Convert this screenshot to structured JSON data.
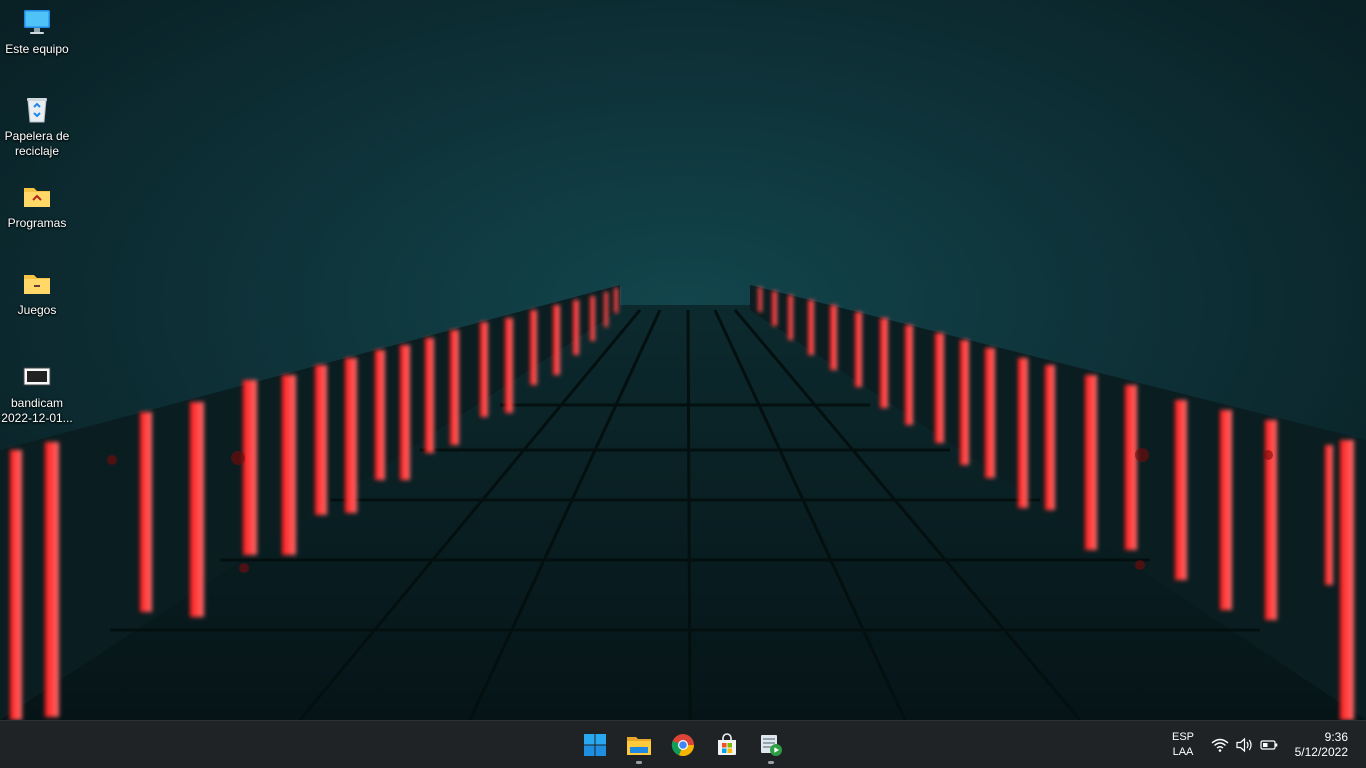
{
  "desktop": {
    "icons": [
      {
        "name": "este-equipo",
        "label": "Este equipo",
        "icon": "monitor-icon"
      },
      {
        "name": "papelera",
        "label": "Papelera de reciclaje",
        "icon": "recycle-bin-icon"
      },
      {
        "name": "programas",
        "label": "Programas",
        "icon": "folder-icon"
      },
      {
        "name": "juegos",
        "label": "Juegos",
        "icon": "folder-icon"
      },
      {
        "name": "bandicam",
        "label": "bandicam 2022-12-01...",
        "icon": "video-file-icon"
      }
    ]
  },
  "taskbar": {
    "apps": [
      {
        "name": "start",
        "icon": "windows-start-icon",
        "running": false
      },
      {
        "name": "file-explorer",
        "icon": "file-explorer-icon",
        "running": true
      },
      {
        "name": "chrome",
        "icon": "chrome-icon",
        "running": false
      },
      {
        "name": "store",
        "icon": "microsoft-store-icon",
        "running": false
      },
      {
        "name": "media-app",
        "icon": "media-player-icon",
        "running": true
      }
    ],
    "tray": {
      "lang_top": "ESP",
      "lang_bottom": "LAA",
      "icons": [
        "wifi-icon",
        "volume-icon",
        "battery-icon"
      ]
    },
    "clock": {
      "time": "9:36",
      "date": "5/12/2022"
    }
  }
}
